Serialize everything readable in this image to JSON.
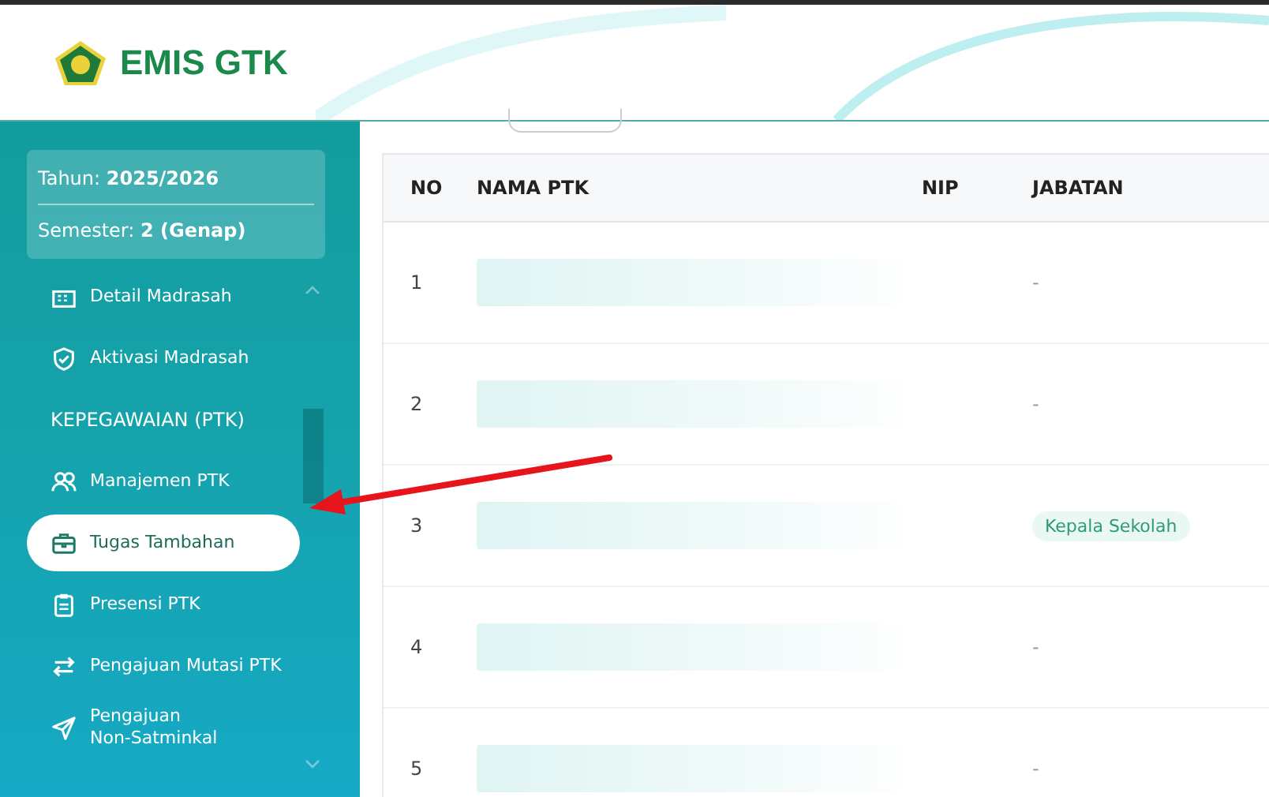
{
  "header": {
    "logo_text": "EMIS GTK"
  },
  "period": {
    "year_label": "Tahun:",
    "year": "2025/2026",
    "semester_label": "Semester:",
    "semester": "2 (Genap)"
  },
  "sidebar": {
    "items": [
      {
        "kind": "item",
        "label": "Detail Madrasah",
        "selected": false
      },
      {
        "kind": "item",
        "label": "Aktivasi Madrasah",
        "selected": false
      },
      {
        "kind": "section",
        "label": "KEPEGAWAIAN (PTK)"
      },
      {
        "kind": "item",
        "label": "Manajemen PTK",
        "selected": false
      },
      {
        "kind": "item",
        "label": "Tugas Tambahan",
        "selected": true
      },
      {
        "kind": "item",
        "label": "Presensi PTK",
        "selected": false
      },
      {
        "kind": "item",
        "label": "Pengajuan Mutasi PTK",
        "selected": false
      },
      {
        "kind": "item",
        "label": "Pengajuan\nNon-Satminkal",
        "selected": false
      }
    ]
  },
  "table": {
    "columns": [
      "NO",
      "NAMA PTK",
      "NIP",
      "JABATAN"
    ],
    "rows": [
      {
        "no": "1",
        "name_redacted": true,
        "jabatan": {
          "kind": "text",
          "text": "-"
        }
      },
      {
        "no": "2",
        "name_redacted": true,
        "jabatan": {
          "kind": "text",
          "text": "-"
        }
      },
      {
        "no": "3",
        "name_redacted": true,
        "jabatan": {
          "kind": "badge",
          "text": "Kepala Sekolah"
        }
      },
      {
        "no": "4",
        "name_redacted": true,
        "jabatan": {
          "kind": "text",
          "text": "-"
        }
      },
      {
        "no": "5",
        "name_redacted": true,
        "jabatan": {
          "kind": "text",
          "text": "-"
        }
      }
    ]
  },
  "annotation_arrow": true
}
